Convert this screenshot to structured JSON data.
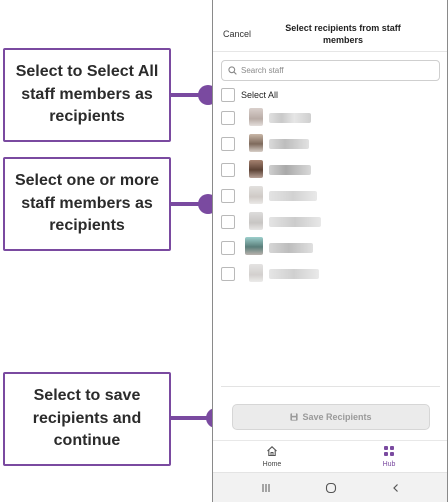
{
  "callouts": [
    {
      "text": "Select to Select All staff members as recipients"
    },
    {
      "text": "Select one or more staff members as recipients"
    },
    {
      "text": "Select to save recipients and continue"
    }
  ],
  "colors": {
    "accent": "#7a4aa0",
    "disabled_button_bg": "#ebebeb",
    "disabled_button_text": "#9a9a9a"
  },
  "header": {
    "cancel_label": "Cancel",
    "title": "Select recipients from staff members"
  },
  "search": {
    "placeholder": "Search staff",
    "icon": "search-icon"
  },
  "select_all": {
    "label": "Select All",
    "checked": false
  },
  "staff_rows": [
    {
      "checked": false,
      "name_redacted": true
    },
    {
      "checked": false,
      "name_redacted": true
    },
    {
      "checked": false,
      "name_redacted": true
    },
    {
      "checked": false,
      "name_redacted": true
    },
    {
      "checked": false,
      "name_redacted": true
    },
    {
      "checked": false,
      "name_redacted": true
    },
    {
      "checked": false,
      "name_redacted": true
    }
  ],
  "save_button": {
    "label": "Save Recipients",
    "icon": "save-icon",
    "enabled": false
  },
  "tabs": [
    {
      "label": "Home",
      "icon": "home-icon",
      "active": false
    },
    {
      "label": "Hub",
      "icon": "grid-icon",
      "active": true
    }
  ],
  "system_nav": {
    "recents": "recents-icon",
    "home": "home-circle-icon",
    "back": "back-icon"
  }
}
